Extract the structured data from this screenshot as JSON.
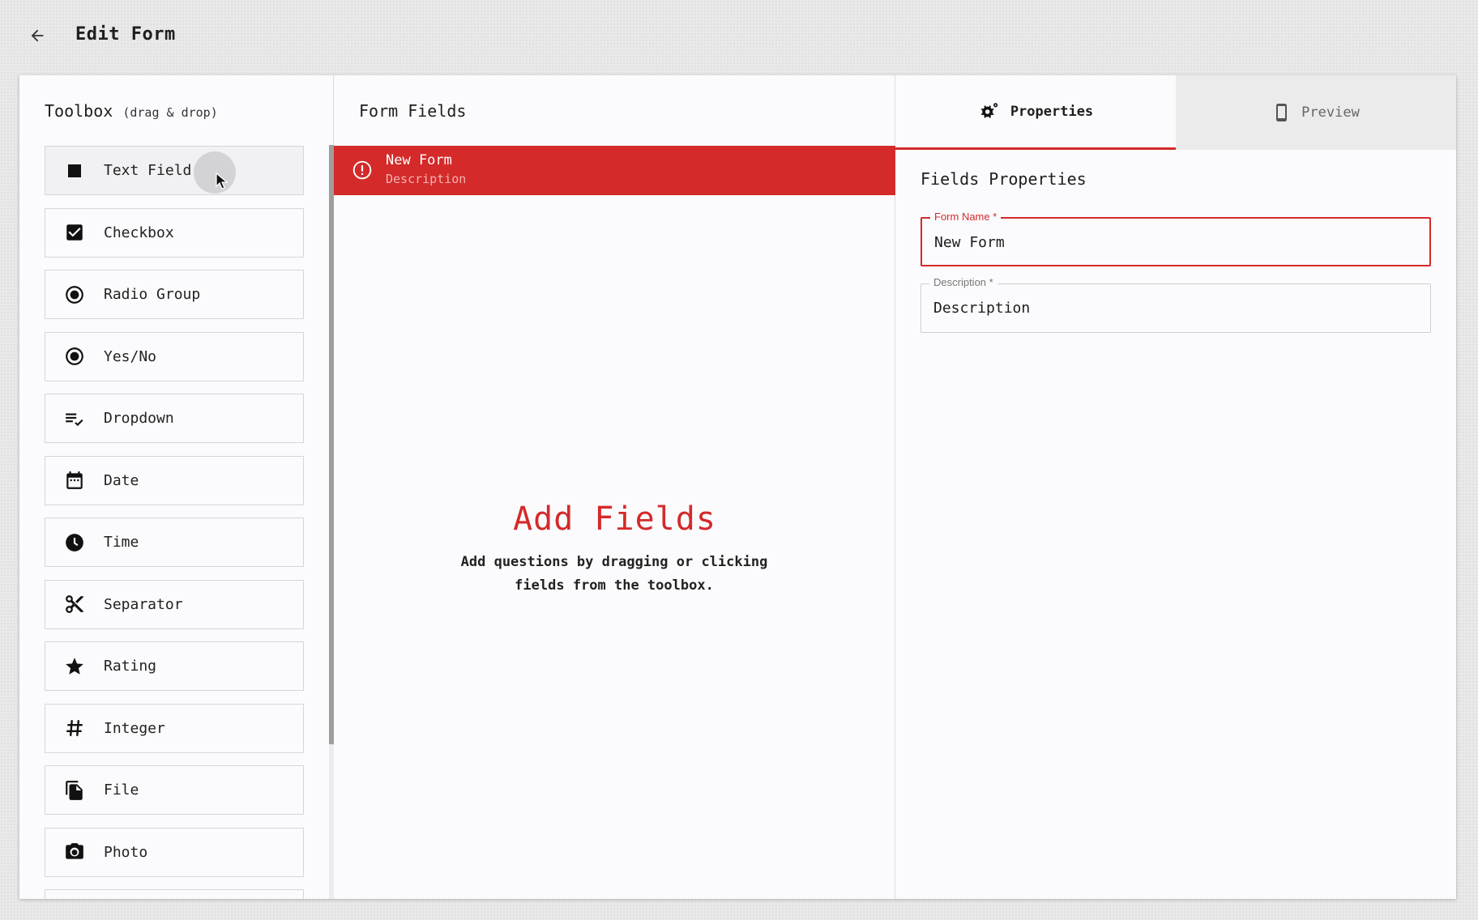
{
  "header": {
    "title": "Edit Form",
    "back_icon": "arrow-left-icon"
  },
  "toolbox": {
    "title": "Toolbox",
    "hint": "(drag & drop)",
    "items": [
      {
        "label": "Text Field",
        "icon": "square-icon"
      },
      {
        "label": "Checkbox",
        "icon": "checkbox-icon"
      },
      {
        "label": "Radio Group",
        "icon": "radio-icon"
      },
      {
        "label": "Yes/No",
        "icon": "radio-icon"
      },
      {
        "label": "Dropdown",
        "icon": "list-check-icon"
      },
      {
        "label": "Date",
        "icon": "calendar-icon"
      },
      {
        "label": "Time",
        "icon": "clock-icon"
      },
      {
        "label": "Separator",
        "icon": "scissors-icon"
      },
      {
        "label": "Rating",
        "icon": "star-icon"
      },
      {
        "label": "Integer",
        "icon": "hash-icon"
      },
      {
        "label": "File",
        "icon": "file-icon"
      },
      {
        "label": "Photo",
        "icon": "camera-icon"
      }
    ]
  },
  "form_fields": {
    "title": "Form Fields",
    "form": {
      "name": "New Form",
      "description": "Description"
    },
    "empty": {
      "heading": "Add Fields",
      "text": "Add questions by dragging or clicking fields from the toolbox."
    }
  },
  "properties": {
    "tabs": [
      {
        "label": "Properties",
        "icon": "gear-icon",
        "active": true
      },
      {
        "label": "Preview",
        "icon": "phone-icon",
        "active": false
      }
    ],
    "title": "Fields Properties",
    "fields": [
      {
        "label": "Form Name *",
        "value": "New Form"
      },
      {
        "label": "Description *",
        "value": "Description"
      }
    ]
  },
  "colors": {
    "accent": "#d42a2a",
    "background": "#e9e9e9",
    "card": "#fbfbfd"
  }
}
